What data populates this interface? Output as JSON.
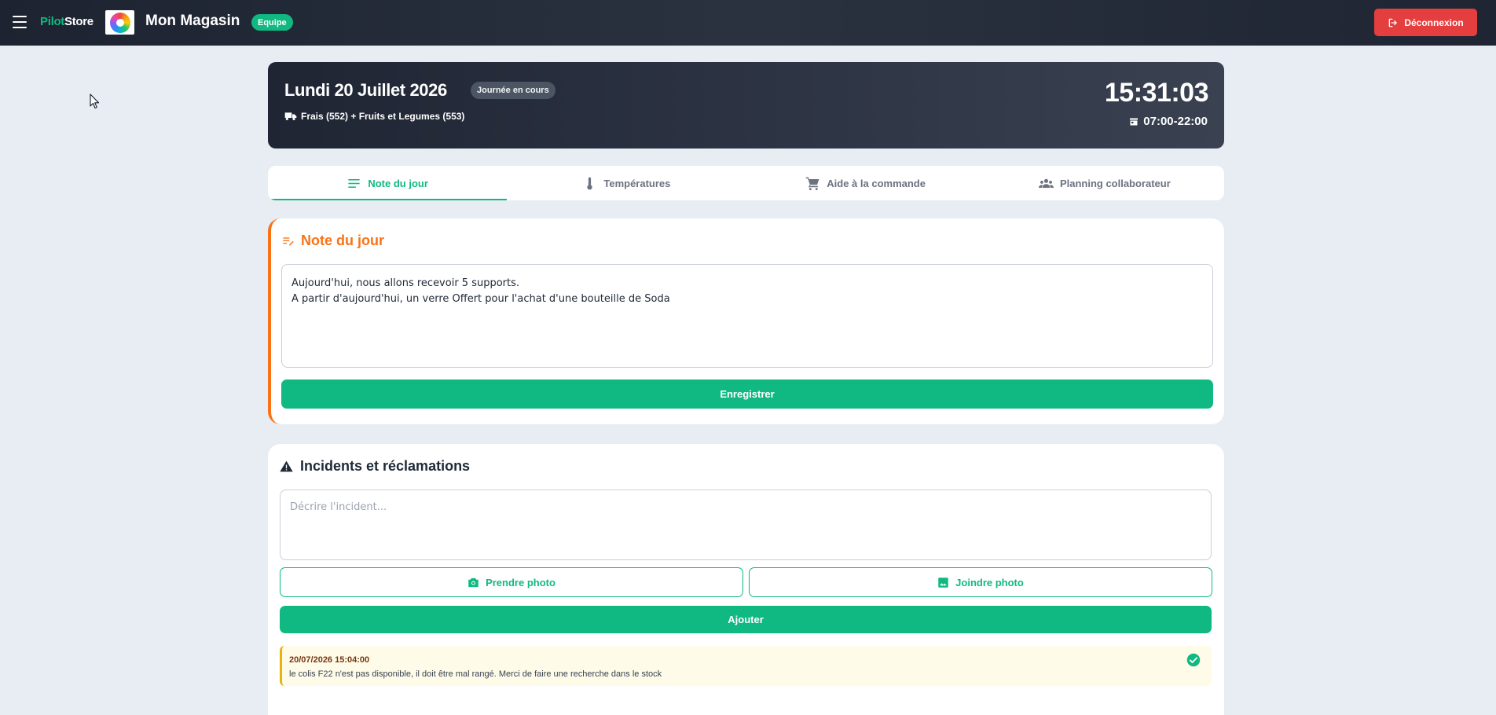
{
  "topbar": {
    "brand_part1": "Pilot",
    "brand_part2": "Store",
    "store_name": "Mon Magasin",
    "team_badge": "Equipe",
    "logout_label": "Déconnexion",
    "logout_color": "#e53e3e"
  },
  "day": {
    "title": "Lundi 20 Juillet 2026",
    "status": "Journée en cours",
    "delivery": "Frais (552) + Fruits et Legumes (553)",
    "clock": "15:31:03",
    "hours": "07:00-22:00"
  },
  "tabs": [
    {
      "label": "Note du jour",
      "icon": "notes-icon",
      "active": true
    },
    {
      "label": "Températures",
      "icon": "thermometer-icon",
      "active": false
    },
    {
      "label": "Aide à la commande",
      "icon": "cart-icon",
      "active": false
    },
    {
      "label": "Planning collaborateur",
      "icon": "group-icon",
      "active": false
    }
  ],
  "note": {
    "title": "Note du jour",
    "text": "Aujourd'hui, nous allons recevoir 5 supports.\nA partir d'aujourd'hui, un verre Offert pour l'achat d'une bouteille de Soda",
    "save_label": "Enregistrer"
  },
  "incidents": {
    "title": "Incidents et réclamations",
    "placeholder": "Décrire l'incident...",
    "take_photo_label": "Prendre photo",
    "join_photo_label": "Joindre photo",
    "add_label": "Ajouter",
    "items": [
      {
        "date": "20/07/2026 15:04:00",
        "text": "le colis F22 n'est pas disponible, il doit être mal rangé. Merci de faire une recherche dans le stock",
        "resolved": true
      }
    ]
  },
  "colors": {
    "accent_green": "#10b981",
    "note_orange": "#f97316",
    "incident_yellow": "#eab308"
  }
}
